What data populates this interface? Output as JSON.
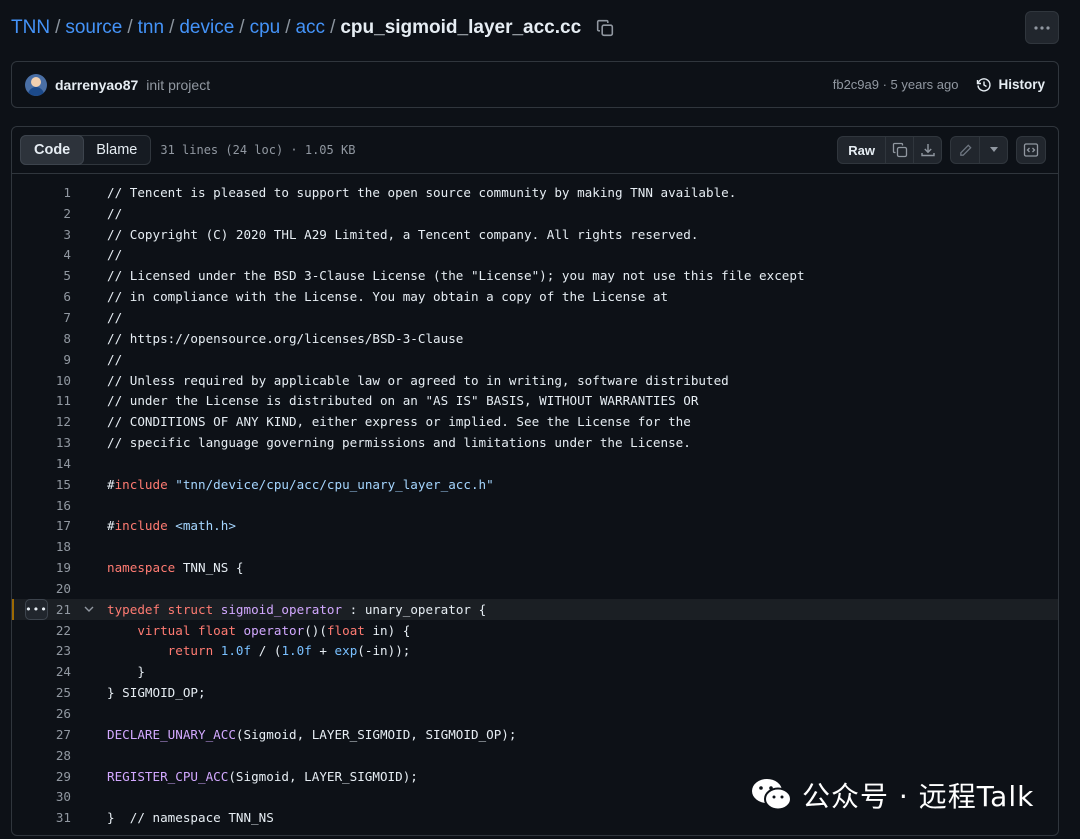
{
  "breadcrumb": {
    "parts": [
      "TNN",
      "source",
      "tnn",
      "device",
      "cpu",
      "acc"
    ],
    "separator": "/",
    "current": "cpu_sigmoid_layer_acc.cc"
  },
  "commit": {
    "author": "darrenyao87",
    "message": "init project",
    "sha_age": "fb2c9a9 · 5 years ago",
    "history_label": "History"
  },
  "file_header": {
    "tabs": [
      "Code",
      "Blame"
    ],
    "info": "31 lines (24 loc) · 1.05 KB",
    "raw_label": "Raw"
  },
  "code": {
    "highlighted_line": 21,
    "lines": [
      [
        [
          "// Tencent is pleased to support the open source community by making TNN available.",
          "cm"
        ]
      ],
      [
        [
          "//",
          "cm"
        ]
      ],
      [
        [
          "// Copyright (C) 2020 THL A29 Limited, a Tencent company. All rights reserved.",
          "cm"
        ]
      ],
      [
        [
          "//",
          "cm"
        ]
      ],
      [
        [
          "// Licensed under the BSD 3-Clause License (the \"License\"); you may not use this file except",
          "cm"
        ]
      ],
      [
        [
          "// in compliance with the License. You may obtain a copy of the License at",
          "cm"
        ]
      ],
      [
        [
          "//",
          "cm"
        ]
      ],
      [
        [
          "// https://opensource.org/licenses/BSD-3-Clause",
          "cm"
        ]
      ],
      [
        [
          "//",
          "cm"
        ]
      ],
      [
        [
          "// Unless required by applicable law or agreed to in writing, software distributed",
          "cm"
        ]
      ],
      [
        [
          "// under the License is distributed on an \"AS IS\" BASIS, WITHOUT WARRANTIES OR",
          "cm"
        ]
      ],
      [
        [
          "// CONDITIONS OF ANY KIND, either express or implied. See the License for the",
          "cm"
        ]
      ],
      [
        [
          "// specific language governing permissions and limitations under the License.",
          "cm"
        ]
      ],
      [],
      [
        [
          "#",
          "pl"
        ],
        [
          "include",
          "kw"
        ],
        [
          " ",
          "pl"
        ],
        [
          "\"tnn/device/cpu/acc/cpu_unary_layer_acc.h\"",
          "str"
        ]
      ],
      [],
      [
        [
          "#",
          "pl"
        ],
        [
          "include",
          "kw"
        ],
        [
          " ",
          "pl"
        ],
        [
          "<math.h>",
          "str"
        ]
      ],
      [],
      [
        [
          "namespace",
          "kw"
        ],
        [
          " TNN_NS {",
          "pl"
        ]
      ],
      [],
      [
        [
          "typedef",
          "kw"
        ],
        [
          " ",
          "pl"
        ],
        [
          "struct",
          "kw"
        ],
        [
          " ",
          "pl"
        ],
        [
          "sigmoid_operator",
          "fn"
        ],
        [
          " : unary_operator {",
          "pl"
        ]
      ],
      [
        [
          "    ",
          "pl"
        ],
        [
          "virtual",
          "kw"
        ],
        [
          " ",
          "pl"
        ],
        [
          "float",
          "kw"
        ],
        [
          " ",
          "pl"
        ],
        [
          "operator",
          "fn"
        ],
        [
          "()(",
          "pl"
        ],
        [
          "float",
          "kw"
        ],
        [
          " in) {",
          "pl"
        ]
      ],
      [
        [
          "        ",
          "pl"
        ],
        [
          "return",
          "kw"
        ],
        [
          " ",
          "pl"
        ],
        [
          "1.0f",
          "num"
        ],
        [
          " / (",
          "pl"
        ],
        [
          "1.0f",
          "num"
        ],
        [
          " + ",
          "pl"
        ],
        [
          "exp",
          "num"
        ],
        [
          "(-in));",
          "pl"
        ]
      ],
      [
        [
          "    }",
          "pl"
        ]
      ],
      [
        [
          "} SIGMOID_OP;",
          "pl"
        ]
      ],
      [],
      [
        [
          "DECLARE_UNARY_ACC",
          "fn"
        ],
        [
          "(Sigmoid, LAYER_SIGMOID, SIGMOID_OP);",
          "pl"
        ]
      ],
      [],
      [
        [
          "REGISTER_CPU_ACC",
          "fn"
        ],
        [
          "(Sigmoid, LAYER_SIGMOID);",
          "pl"
        ]
      ],
      [],
      [
        [
          "}  // namespace TNN_NS",
          "pl"
        ]
      ]
    ]
  },
  "watermark": {
    "text": "公众号 · 远程Talk"
  },
  "icons": [
    "copy-icon",
    "kebab-icon",
    "history-icon",
    "download-icon",
    "pencil-icon",
    "triangle-down-icon",
    "symbols-panel-icon",
    "chevron-down-icon",
    "wechat-logo"
  ],
  "colors": {
    "background": "#0d1117",
    "link": "#4493f8",
    "keyword": "#ff7b72",
    "string": "#a5d6ff",
    "function": "#d2a8ff",
    "number": "#79c0ff"
  }
}
